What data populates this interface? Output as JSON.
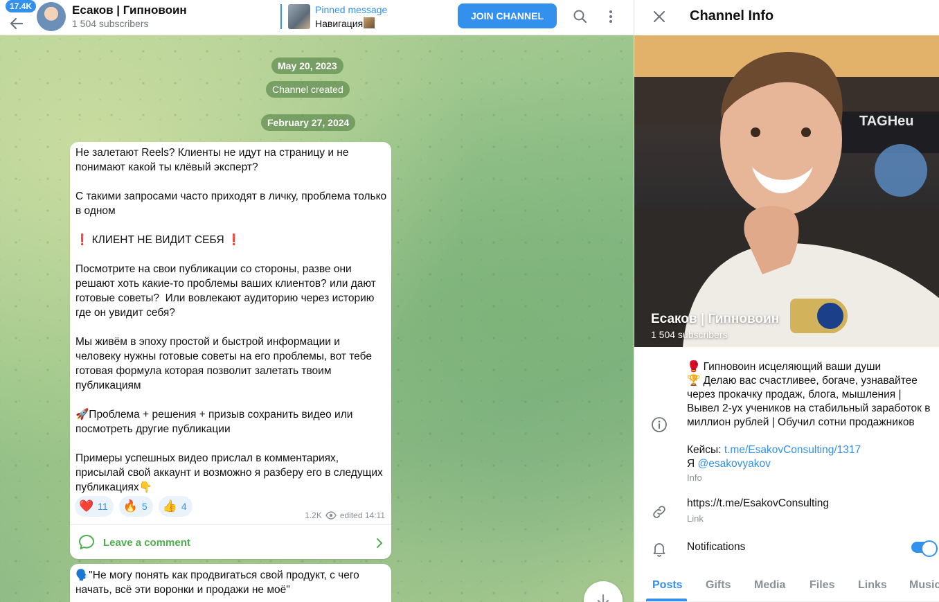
{
  "header": {
    "back_badge": "17.4K",
    "title": "Есаков | Гипновоин",
    "subscribers": "1 504 subscribers",
    "pinned_label": "Pinned message",
    "pinned_text": "Навигация",
    "join_label": "JOIN CHANNEL"
  },
  "chat": {
    "date_1": "May 20, 2023",
    "service_1": "Channel created",
    "date_2": "February 27, 2024",
    "message_1": {
      "text": "Не залетают Reels? Клиенты не идут на страницу и не понимают какой ты клёвый эксперт?\n\nС такими запросами часто приходят в личку, проблема только в одном\n\n❗ КЛИЕНТ НЕ ВИДИТ СЕБЯ ❗\n\nПосмотрите на свои публикации со стороны, разве они решают хоть какие-то проблемы ваших клиентов? или дают готовые советы?  Или вовлекают аудиторию через историю где он увидит себя?\n\nМы живём в эпоху простой и быстрой информации и человеку нужны готовые советы на его проблемы, вот тебе готовая формула которая позволит залетать твоим публикациям\n\n🚀Проблема + решения + призыв сохранить видео или посмотреть другие публикации\n\nПримеры успешных видео прислал в комментариях, присылай свой аккаунт и возможно я разберу его в следущих публикациях👇",
      "reactions": [
        {
          "emoji": "❤️",
          "count": "11"
        },
        {
          "emoji": "🔥",
          "count": "5"
        },
        {
          "emoji": "👍",
          "count": "4"
        }
      ],
      "views": "1.2K",
      "edited": "edited 14:11",
      "comment_label": "Leave a comment"
    },
    "message_2": {
      "text": "🗣️\"Не могу понять как продвигаться свой продукт, с чего начать, всё эти воронки и продажи не моё\""
    }
  },
  "panel": {
    "title": "Channel Info",
    "name": "Есаков | Гипновоин",
    "subscribers": "1 504 subscribers",
    "description": "🥊 Гипновоин исцеляющий ваши души\n🏆 Делаю вас счастливее, богаче, узнавайтее через прокачку продаж, блога, мышления | Вывел 2-ух учеников на стабильный заработок в миллион рублей | Обучил сотни продажников",
    "cases_label": "Кейсы: ",
    "cases_link": "t.me/EsakovConsulting/1317",
    "me_label": "Я ",
    "me_link": "@esakovyakov",
    "info_caption": "Info",
    "link_value": "https://t.me/EsakovConsulting",
    "link_caption": "Link",
    "notifications_label": "Notifications",
    "notifications_on": true,
    "tabs": [
      "Posts",
      "Gifts",
      "Media",
      "Files",
      "Links",
      "Music"
    ]
  },
  "colors": {
    "accent": "#3390ec",
    "comment_green": "#4fae4e"
  }
}
